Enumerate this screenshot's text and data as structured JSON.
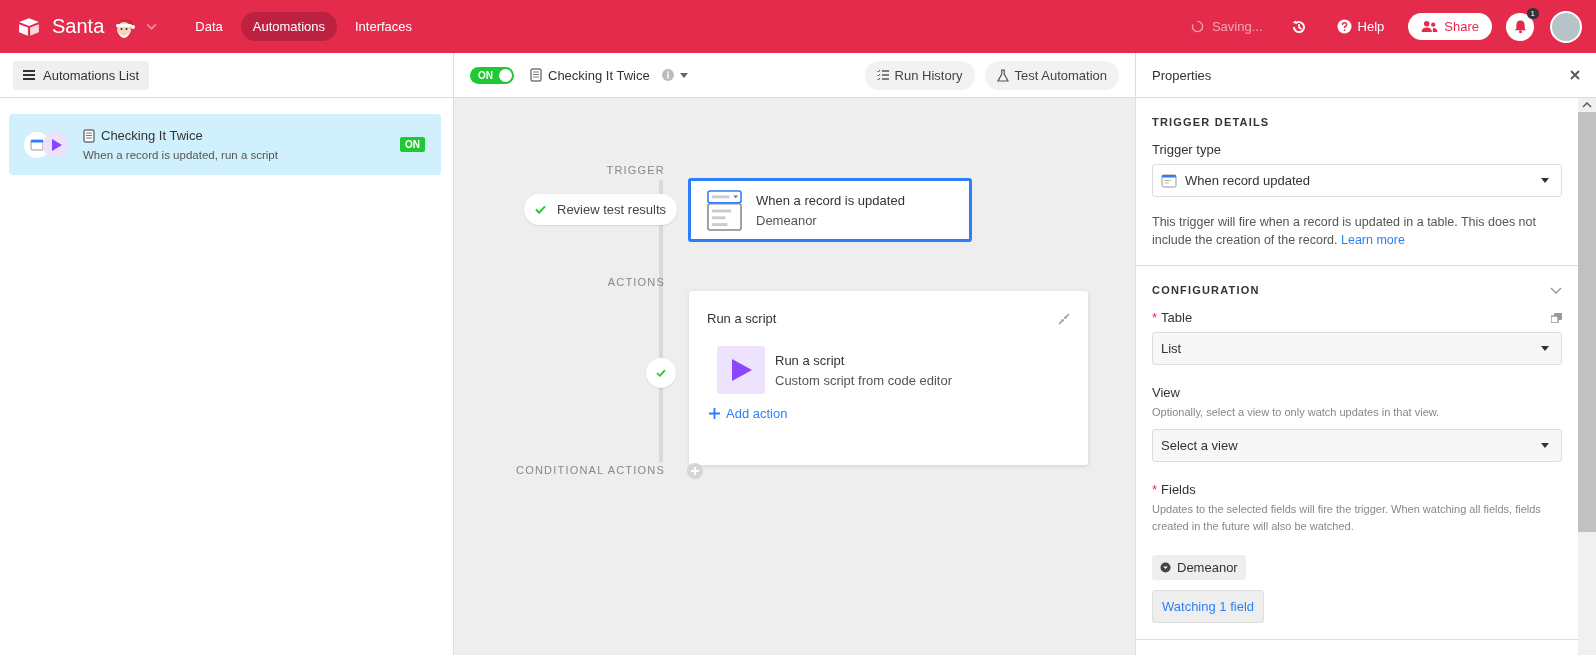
{
  "topbar": {
    "app_name": "Santa",
    "nav": [
      {
        "label": "Data",
        "selected": false
      },
      {
        "label": "Automations",
        "selected": true
      },
      {
        "label": "Interfaces",
        "selected": false
      }
    ],
    "saving": "Saving...",
    "help": "Help",
    "share": "Share",
    "notification_count": "1"
  },
  "sidebar": {
    "list_button": "Automations List",
    "items": [
      {
        "title": "Checking It Twice",
        "subtitle": "When a record is updated, run a script",
        "badge": "ON",
        "selected": true
      }
    ]
  },
  "toolbar": {
    "toggle": {
      "label": "ON",
      "on": true
    },
    "title": "Checking It Twice",
    "buttons": [
      "Run History",
      "Test Automation"
    ]
  },
  "canvas": {
    "trigger_label": "TRIGGER",
    "review_button": "Review test results",
    "trigger_card": {
      "title": "When a record is updated",
      "subtitle": "Demeanor",
      "selected": true
    },
    "actions_label": "ACTIONS",
    "action_card": {
      "header": "Run a script",
      "title": "Run a script",
      "subtitle": "Custom script from code editor",
      "add": "Add action"
    },
    "conditional_label": "CONDITIONAL ACTIONS"
  },
  "properties": {
    "title": "Properties",
    "trigger_heading": "TRIGGER DETAILS",
    "trigger_type_label": "Trigger type",
    "trigger_type_value": "When record updated",
    "trigger_help": "This trigger will fire when a record is updated in a table. This does not include the creation of the record.",
    "learn_more": "Learn more",
    "config_heading": "CONFIGURATION",
    "table_label": "Table",
    "table_required_mark": "*",
    "table_value": "List",
    "view_label": "View",
    "view_help": "Optionally, select a view to only watch updates in that view.",
    "view_placeholder": "Select a view",
    "fields_label": "Fields",
    "fields_required_mark": "*",
    "fields_help": "Updates to the selected fields will fire the trigger. When watching all fields, fields created in the future will also be watched.",
    "field_chips": [
      "Demeanor"
    ],
    "watching_button": "Watching 1 field"
  }
}
